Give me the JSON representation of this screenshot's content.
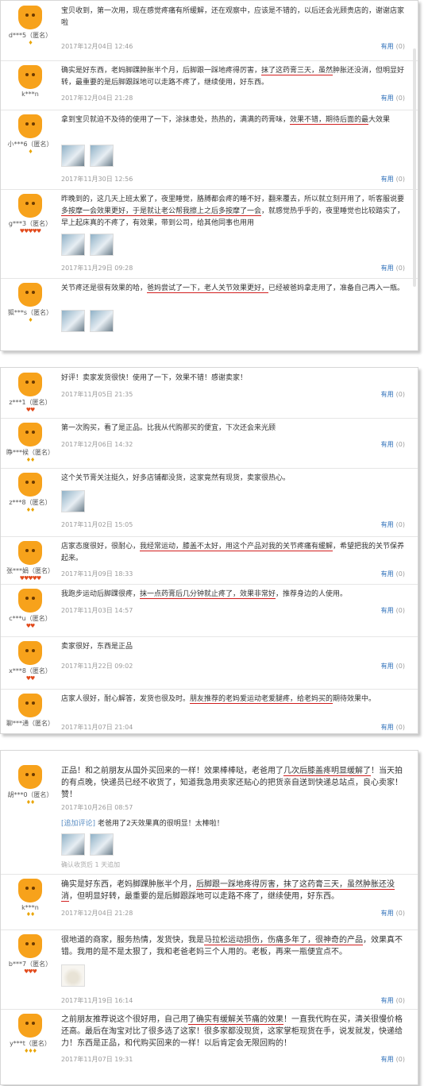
{
  "helpful_label": "有用",
  "panels": [
    {
      "reviews": [
        {
          "user": "d***5（匿名）",
          "level": "♦",
          "text": "宝贝收到，第一次用，现在感觉疼痛有所缓解，还在观察中，应该是不错的，以后还会光顾贵店的，谢谢店家啦",
          "date": "2017年12月04日 12:46",
          "helpful": "(0)"
        },
        {
          "user": "k***n",
          "level": "",
          "text": "确实是好东西，老妈脚踝肿胀半个月，后脚跟一踩地疼得厉害，抹了这药膏三天，虽然肿胀还没消，但明显好转，最重要的是后脚跟踩地可以走路不疼了，继续使用，好东西。",
          "date": "2017年12月04日 21:28",
          "helpful": "(0)"
        },
        {
          "user": "小***6（匿名）",
          "level": "♦",
          "text": "拿到宝贝就迫不及待的使用了一下，涂抹患处，热热的，满满的药膏味，效果不错，期待后面的最大效果",
          "date": "2017年11月30日 12:56",
          "helpful": "(0)"
        },
        {
          "user": "g***3（匿名）",
          "level": "♥♥♥♥♥",
          "text": "昨晚到的，这几天上班太累了，夜里睡觉，胳膊都会疼的睡不好，翻来覆去，所以就立刻开用了，听客服说要多按摩一会效果更好，于是就让老公帮我擦上之后多按摩了一会，就感觉热乎乎的，夜里睡觉也比较踏实了，早上起床真的不疼了，有效果，带到公司，给其他同事也用用",
          "date": "2017年11月29日 09:28",
          "helpful": "(0)"
        },
        {
          "user": "狐***s（匿名）",
          "level": "♦",
          "text": "关节疼还是很有效果的哈，爸妈尝试了一下，老人关节效果更好，已经被爸妈拿走用了，准备自己再入一瓶。",
          "date": "",
          "helpful": ""
        }
      ]
    },
    {
      "reviews": [
        {
          "user": "z***1（匿名）",
          "level": "♥♥",
          "text": "好评！卖家发货很快！使用了一下，效果不错！感谢卖家！",
          "date": "2017年11月05日 21:35",
          "helpful": "(0)"
        },
        {
          "user": "睁***候（匿名）",
          "level": "♦♦",
          "text": "第一次购买，看了是正品。比我从代购那买的便宜，下次还会来光顾",
          "date": "2017年12月06日 14:32",
          "helpful": "(0)"
        },
        {
          "user": "z***8（匿名）",
          "level": "♦♦",
          "text": "这个关节膏关注挺久，好多店铺都没货，这家竟然有现货，卖家很热心。",
          "date": "2017年11月02日 15:05",
          "helpful": "(0)"
        },
        {
          "user": "张***娟（匿名）",
          "level": "♥♥♥♥♥",
          "text": "店家态度很好，很耐心，我经常运动，膝盖不太好，用这个产品对我的关节疼痛有缓解，希望把我的关节保养起来。",
          "date": "2017年11月09日 18:33",
          "helpful": "(0)"
        },
        {
          "user": "c***u（匿名）",
          "level": "♥♥",
          "text": "我跑步运动后脚踝很疼，抹一点药膏后几分钟就止疼了，效果非常好，推荐身边的人使用。",
          "date": "2017年11月03日 14:57",
          "helpful": "(0)"
        },
        {
          "user": "x***8（匿名）",
          "level": "♥♥",
          "text": "卖家很好，东西是正品",
          "date": "2017年11月22日 09:02",
          "helpful": "(0)"
        },
        {
          "user": "聊***通（匿名）",
          "level": "",
          "text": "店家人很好，耐心解答，发货也很及时。朋友推荐的老妈爱运动老爱腿疼，给老妈买的期待效果中。",
          "date": "2017年11月07日 21:04",
          "helpful": "(0)"
        }
      ]
    },
    {
      "reviews": [
        {
          "user": "胡***0（匿名）",
          "level": "♦♦",
          "text": "正品！和之前朋友从国外买回来的一样！效果棒棒哒，老爸用了几次后膝盖疼明显缓解了！当天拍的有点晚，快递员已经不收货了，知道我急用卖家还贴心的把货亲自送到快递总站点，良心卖家！赞！",
          "date": "2017年10月26日 08:57",
          "helpful": "",
          "follow_tag": "[追加评论]",
          "follow_text": "老爸用了2天效果真的很明显！太棒啦！",
          "follow_meta": "确认收货后 1 天追加"
        },
        {
          "user": "k***n",
          "level": "♦♦",
          "text": "确实是好东西，老妈脚踝肿胀半个月，后脚跟一踩地疼得厉害，抹了这药膏三天，虽然肿胀还没消，但明显好转，最重要的是后脚跟踩地可以走路不疼了，继续使用，好东西。",
          "date": "2017年12月04日 21:28",
          "helpful": "(0)"
        },
        {
          "user": "b***7（匿名）",
          "level": "♥♥♥",
          "text": "很地道的商家，服务热情，发货快，我是马拉松运动损伤，伤痛多年了，很神奇的产品，效果真不错。我用的是不是太狠了，我和老爸老妈三个人用的。老板，再来一瓶便宜点不。",
          "date": "2017年11月19日 16:14",
          "helpful": "(0)"
        },
        {
          "user": "y***t（匿名）",
          "level": "♦♦♦",
          "text": "之前朋友推荐说这个很好用，自己用了确实有缓解关节痛的效果！一直我代购在买，清关很慢价格还高。最后在淘宝对比了很多选了这家！很多家都没现货，这家掌柜现货在手，说发就发，快递给力！东西是正品，和代购买回来的一样！以后肯定会无限回购的！",
          "date": "2017年11月07日 19:31",
          "helpful": "(0)"
        }
      ]
    }
  ]
}
